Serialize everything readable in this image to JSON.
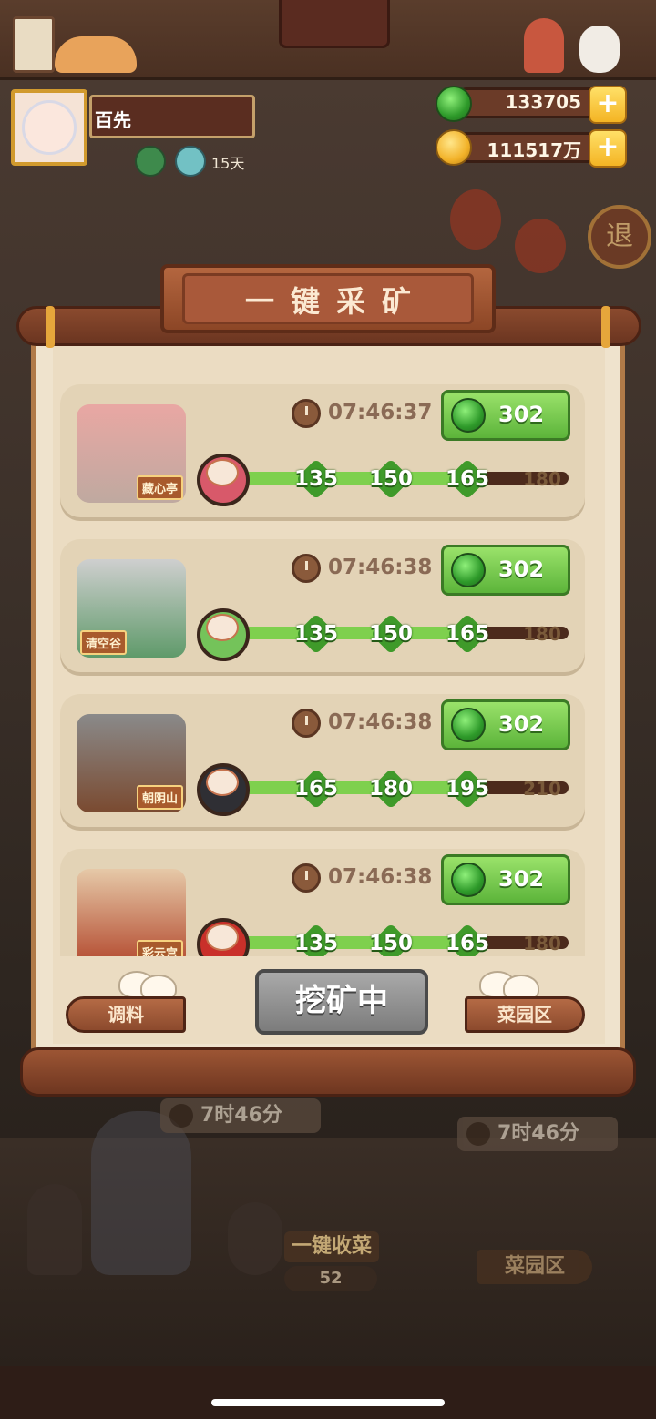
{
  "player": {
    "name": "百先",
    "days": "15天"
  },
  "currency": {
    "jade": "133705",
    "coins": "111517万"
  },
  "deco": {
    "return_char": "退"
  },
  "modal": {
    "title": "一键采矿",
    "mines": [
      {
        "name": "藏心亭",
        "timer": "07:46:37",
        "yield": "302",
        "bowl_color": "#d8596a",
        "milestones": [
          "135",
          "150",
          "165",
          "180"
        ],
        "progress_fraction": 0.75
      },
      {
        "name": "清空谷",
        "timer": "07:46:38",
        "yield": "302",
        "bowl_color": "#74c35a",
        "milestones": [
          "135",
          "150",
          "165",
          "180"
        ],
        "progress_fraction": 0.75
      },
      {
        "name": "朝阴山",
        "timer": "07:46:38",
        "yield": "302",
        "bowl_color": "#2f2f34",
        "milestones": [
          "165",
          "180",
          "195",
          "210"
        ],
        "progress_fraction": 0.75
      },
      {
        "name": "彩云宫",
        "timer": "07:46:38",
        "yield": "302",
        "bowl_color": "#c9302a",
        "milestones": [
          "135",
          "150",
          "165",
          "180"
        ],
        "progress_fraction": 0.75
      }
    ],
    "buttons": {
      "left": "调料",
      "center": "挖矿中",
      "right": "菜园区"
    }
  },
  "background_scene": {
    "timer_left": "7时46分",
    "timer_right": "7时46分",
    "harvest_label": "一键收菜",
    "harvest_count": "52",
    "garden_label": "菜园区"
  }
}
